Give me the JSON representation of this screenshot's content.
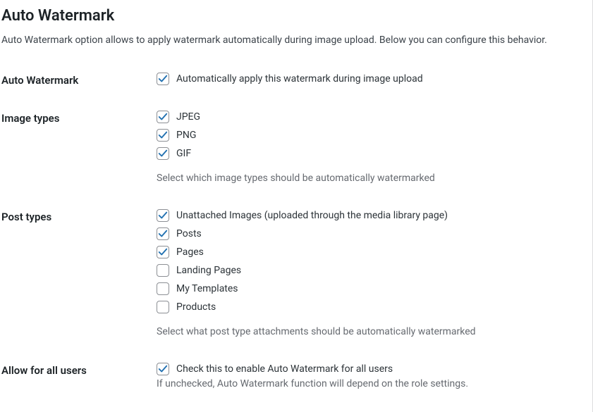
{
  "section": {
    "title": "Auto Watermark",
    "description": "Auto Watermark option allows to apply watermark automatically during image upload. Below you can configure this behavior."
  },
  "fields": {
    "auto_watermark": {
      "label": "Auto Watermark",
      "option_label": "Automatically apply this watermark during image upload",
      "checked": true
    },
    "image_types": {
      "label": "Image types",
      "helper": "Select which image types should be automatically watermarked",
      "options": [
        {
          "label": "JPEG",
          "checked": true
        },
        {
          "label": "PNG",
          "checked": true
        },
        {
          "label": "GIF",
          "checked": true
        }
      ]
    },
    "post_types": {
      "label": "Post types",
      "helper": "Select what post type attachments should be automatically watermarked",
      "options": [
        {
          "label": "Unattached Images (uploaded through the media library page)",
          "checked": true
        },
        {
          "label": "Posts",
          "checked": true
        },
        {
          "label": "Pages",
          "checked": true
        },
        {
          "label": "Landing Pages",
          "checked": false
        },
        {
          "label": "My Templates",
          "checked": false
        },
        {
          "label": "Products",
          "checked": false
        }
      ]
    },
    "allow_all_users": {
      "label": "Allow for all users",
      "option_label": "Check this to enable Auto Watermark for all users",
      "helper": "If unchecked, Auto Watermark function will depend on the role settings.",
      "checked": true
    }
  }
}
